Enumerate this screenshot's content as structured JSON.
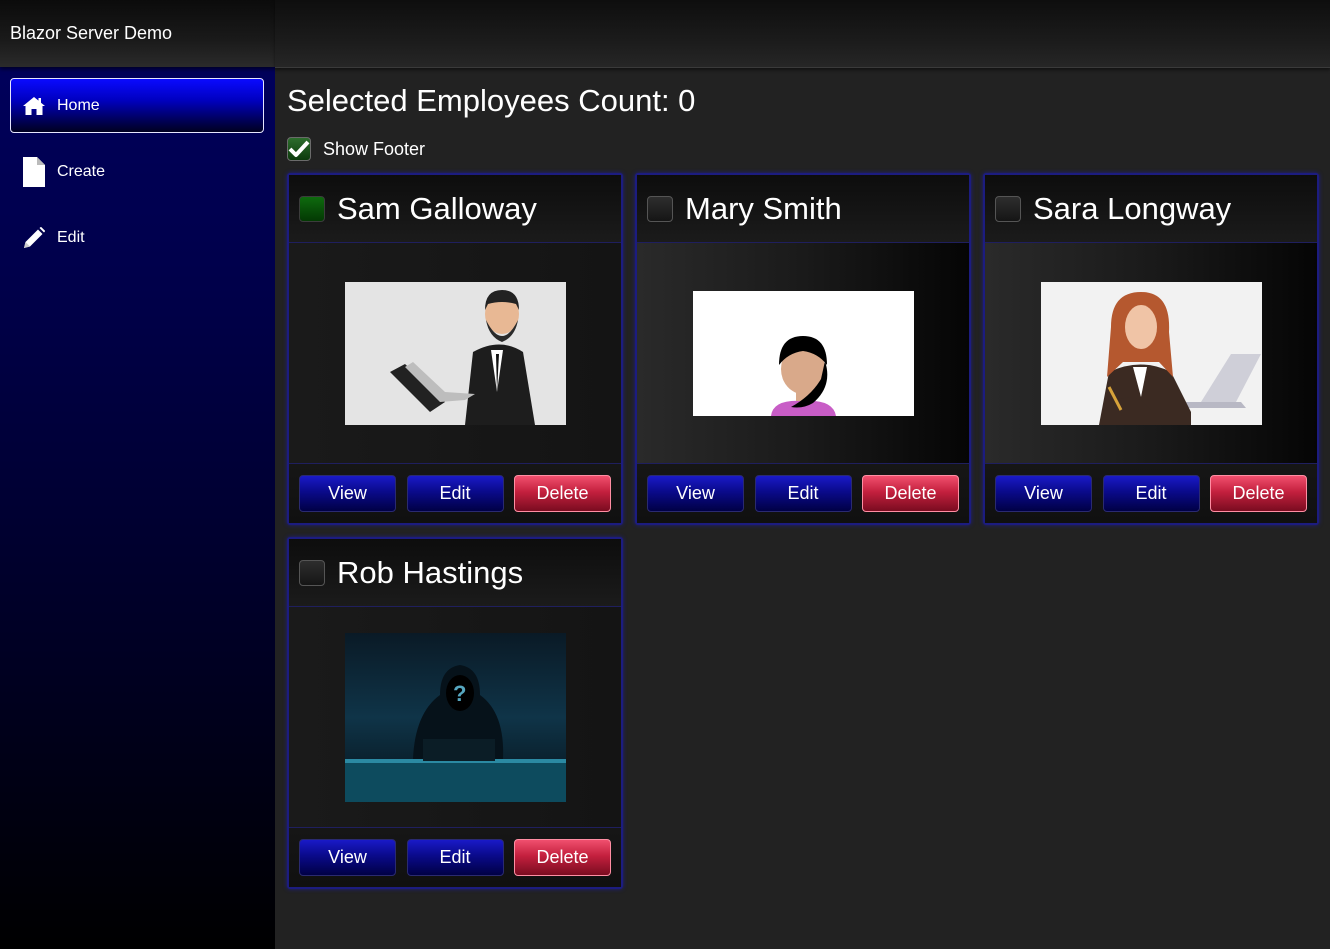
{
  "app": {
    "brand": "Blazor Server Demo"
  },
  "sidebar": {
    "items": [
      {
        "label": "Home",
        "icon": "home-icon",
        "active": true
      },
      {
        "label": "Create",
        "icon": "file-icon",
        "active": false
      },
      {
        "label": "Edit",
        "icon": "pencil-icon",
        "active": false
      }
    ]
  },
  "main": {
    "count_title": "Selected Employees Count: 0",
    "show_footer_label": "Show Footer",
    "show_footer_checked": true
  },
  "employees": [
    {
      "name": "Sam Galloway",
      "selected": false,
      "photo": "man-with-laptop-illustration"
    },
    {
      "name": "Mary Smith",
      "selected": false,
      "photo": "woman-avatar-illustration"
    },
    {
      "name": "Sara Longway",
      "selected": false,
      "photo": "woman-at-desk-illustration"
    },
    {
      "name": "Rob Hastings",
      "selected": false,
      "photo": "hooded-hacker-photo"
    }
  ],
  "card_buttons": {
    "view": "View",
    "edit": "Edit",
    "delete": "Delete"
  },
  "colors": {
    "accent_blue": "#0000c0",
    "danger_red": "#c4203e",
    "card_border": "#1c1c80",
    "background": "#222222"
  }
}
